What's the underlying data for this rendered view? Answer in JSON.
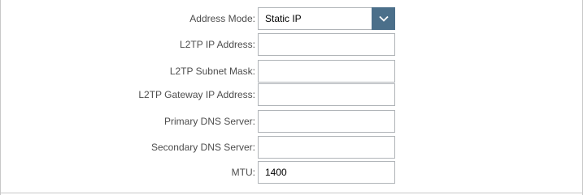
{
  "form": {
    "address_mode": {
      "label": "Address Mode:",
      "value": "Static IP",
      "icon": "chevron-down-icon",
      "button_color": "#4b6f8a"
    },
    "l2tp_ip_address": {
      "label": "L2TP IP Address:",
      "value": ""
    },
    "l2tp_subnet_mask": {
      "label": "L2TP Subnet Mask:",
      "value": ""
    },
    "l2tp_gateway_ip_address": {
      "label": "L2TP Gateway IP Address:",
      "value": ""
    },
    "primary_dns_server": {
      "label": "Primary DNS Server:",
      "value": ""
    },
    "secondary_dns_server": {
      "label": "Secondary DNS Server:",
      "value": ""
    },
    "mtu": {
      "label": "MTU:",
      "value": "1400"
    }
  }
}
